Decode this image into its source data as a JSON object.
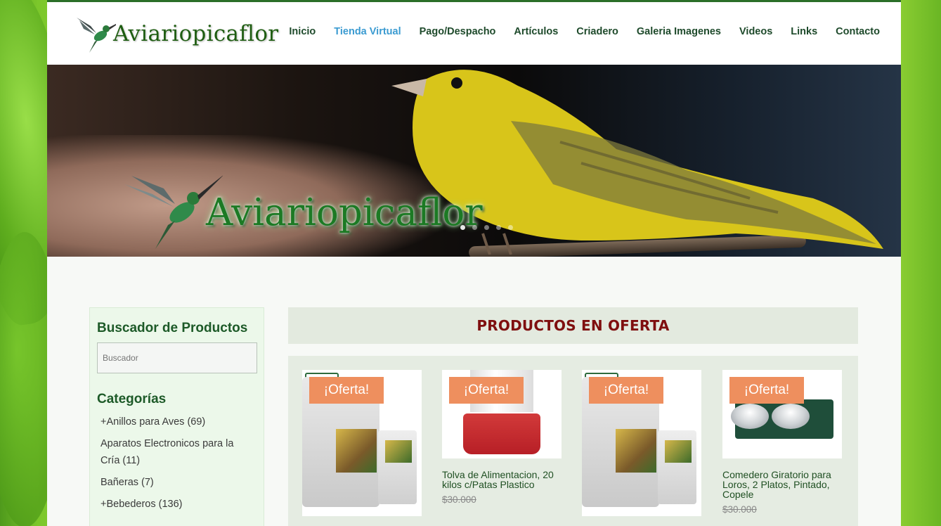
{
  "brand": {
    "name": "Aviariopicaflor"
  },
  "nav": {
    "items": [
      {
        "label": "Inicio"
      },
      {
        "label": "Tienda Virtual"
      },
      {
        "label": "Pago/Despacho"
      },
      {
        "label": "Artículos"
      },
      {
        "label": "Criadero"
      },
      {
        "label": "Galeria Imagenes"
      },
      {
        "label": "Videos"
      },
      {
        "label": "Links"
      },
      {
        "label": "Contacto"
      }
    ],
    "active": "Tienda Virtual"
  },
  "hero": {
    "title": "Aviariopicaflor",
    "slide_count": 5,
    "current_slide": 1
  },
  "sidebar": {
    "search_title": "Buscador de Productos",
    "search_placeholder": "Buscador",
    "categories_title": "Categorías",
    "categories": [
      {
        "label": "+Anillos para Aves (69)"
      },
      {
        "label": "Aparatos Electronicos para la Cría (11)"
      },
      {
        "label": "Bañeras (7)"
      },
      {
        "label": "+Bebederos (136)"
      }
    ]
  },
  "offers": {
    "title": "PRODUCTOS EN OFERTA",
    "badge": "¡Oferta!",
    "products": [
      {
        "name": "",
        "price": "",
        "image": "seed-bag"
      },
      {
        "name": "Tolva de Alimentacion, 20 kilos c/Patas Plastico",
        "price": "$30.000",
        "image": "feeder"
      },
      {
        "name": "",
        "price": "",
        "image": "seed-bag"
      },
      {
        "name": "Comedero Giratorio para Loros, 2 Platos, Pintado, Copele",
        "price": "$30.000",
        "image": "bowls"
      }
    ]
  },
  "colors": {
    "nav_text": "#1e4a2b",
    "nav_active": "#3b9bd1",
    "offer_title": "#7f0f0f",
    "badge_bg": "#ee8f5e",
    "top_border": "#2a6f28"
  }
}
